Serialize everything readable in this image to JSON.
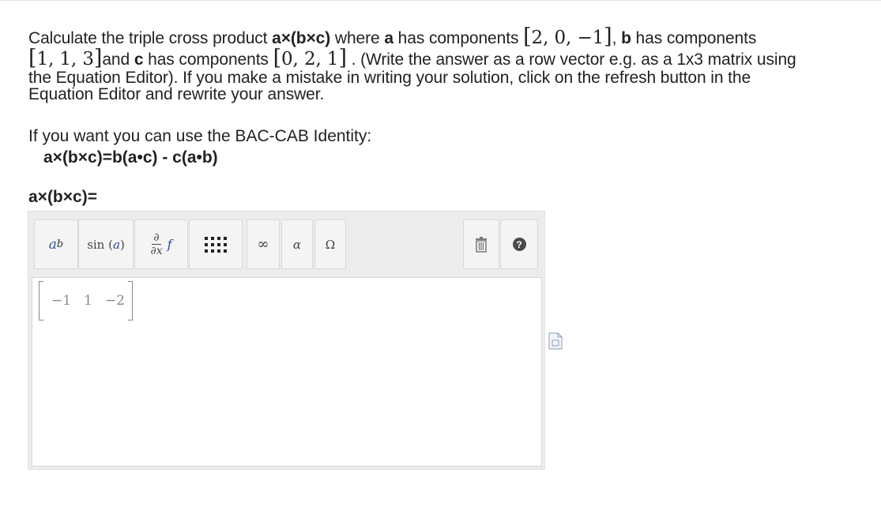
{
  "question": {
    "t1": "Calculate the triple cross product ",
    "expr": "a×(b×c)",
    "t2": " where ",
    "a": "a",
    "t3": " has components ",
    "vec_a": "2, 0, −1",
    "t4": ", ",
    "b": "b",
    "t5": " has components",
    "vec_b": "1, 1, 3",
    "t6": "and ",
    "c": "c",
    "t7": " has components ",
    "vec_c": "0, 2, 1",
    "t8": " . (Write the answer as a row vector e.g. as a 1x3 matrix using",
    "line3": "the Equation Editor). If you make a mistake in writing your solution, click on the refresh button in the",
    "line4": "Equation Editor and rewrite your answer."
  },
  "identity": {
    "intro": "If you want you can use the BAC-CAB Identity:",
    "formula": "a×(b×c)=b(a•c) - c(a•b)"
  },
  "answer_label": "a×(b×c)=",
  "toolbar": {
    "superscript": {
      "base": "a",
      "exp": "b"
    },
    "function": {
      "name": "sin",
      "open": "(",
      "var": "a",
      "close": ")"
    },
    "derivative": {
      "num": "∂",
      "den": "∂x",
      "f": "f"
    },
    "infinity": "∞",
    "alpha": "α",
    "omega": "Ω",
    "help": "?"
  },
  "answer_matrix": [
    "−1",
    "1",
    "−2"
  ]
}
